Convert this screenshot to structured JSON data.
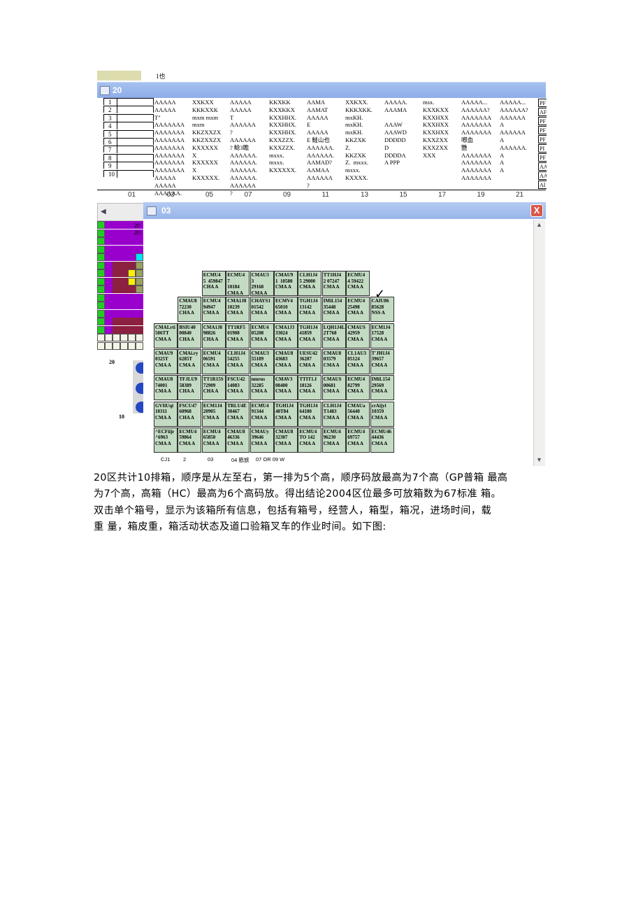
{
  "back_window": {
    "tab_note": "1也",
    "title": "20",
    "rows": [
      "1",
      "2",
      "3",
      "4",
      "5",
      "6",
      "7",
      "8",
      "9",
      "10"
    ],
    "columns": [
      {
        "label": "01",
        "text": "AAAAA\nAAAAA\nT\"\nAAAAAAA\nAAAAAAA\nAAAAAAA\nAAAAAAA\nAAAAAAA\nAAAAAAA\nAAAAAAA\nAAAAA\nAAAAA\nAAAAAA."
      },
      {
        "label": "03",
        "text": "XXKXX\nKKKXXK\nmxm mxm\nmxm\nKKZXXZX\nKKZXXZX\nKXXXXX\nX\nKXXXXX\nX\nKXXXXX."
      },
      {
        "label": "05",
        "text": "AAAAA\nAAAAA\nT\nAAAAAA\n?\nAAAAAA\n? 鲶3瞻\nAAAAAA.\nAAAAAA.\nAAAAAA.\nAAAAAA.\nAAAAAA\n?"
      },
      {
        "label": "07",
        "text": "KKXKK\nKXXKKX\nKXXHHX.\nKXXHHX.\nKXXHHX.\nKXXZZX.\nKXXZZX.\nmxxx.\nmxxx.\nKXXXXX."
      },
      {
        "label": "09",
        "text": "AAMA\nAAMAT\nAAAAA\nE\nAAAAA\nE 鮭山也\nAAAAAA.\nAAAAAA.\nAAMAD?\nAAMAA\nAAAAAA\n?"
      },
      {
        "label": "11",
        "text": "XXKXX.\nKKKXKK.\nmxKH.\nmxKH.\nmxKH.\nKKZXK\nZ.\nKKZXK\nZ.  mxxx.\nmxxx.\nKXXXX."
      },
      {
        "label": "13",
        "text": "AAAAA.\nAAAMA\n\nAAAW\nAAAWD\nDDDDD\nD\nDDDDA\nA PPP"
      },
      {
        "label": "15",
        "text": "msx.\nKXXKXX\nKXXHXX\nKXXHXX\nKXXHXX\nKXXZXX\nKXXZXX\nXXX"
      },
      {
        "label": "17",
        "text": "AAAAA...\nAAAAAA?\nAAAAAAA\nAAAAAAA\nAAAAAAA\n喞血\n艷\nAAAAAAA\nAAAAAAA\nAAAAAAA\nAAAAAAA"
      },
      {
        "label": "19",
        "text": "AAAAA...\nAAAAAA?\nAAAAAA\nA\nAAAAAA\nA\nAAAAAA.\nA\nA\nA"
      }
    ],
    "extra_labels": [
      "21"
    ],
    "right_codes": [
      "PF",
      "AF",
      "PF",
      "PF",
      "PF",
      "PI",
      "PF",
      "AA",
      "AA",
      "AI"
    ]
  },
  "left_panel": {
    "label_a": "20",
    "label_b": "20:",
    "label_c": "20",
    "label_d": "10"
  },
  "main_window": {
    "title": "03",
    "close_label": "X",
    "bay": {
      "rows": [
        [
          "",
          "",
          "ECMU4\n5  459847\nCHA A",
          "ECMU4\n7\n10184\nCMA A",
          "CMAU3\n3\n29168\nCMA A",
          "CMAU9\n1  10580\nCMA A",
          "CLH1J4\n5 29000\nCMA A",
          "TT1HJ4\n2 07247\nCMA A",
          "ECMU4\n4 59422\nCMA A",
          ""
        ],
        [
          "",
          "CMAU8\n72230\nCHA A",
          "ECMU4\n94947\nCMA A",
          "CMA1J8\n10239\nCMA A",
          "CHAYS1\n01542\nCMA A",
          "ECMV4\n65010\nCMA A",
          "TGH1J4\n13142\nCMA A",
          "IMiL154\n35448\nCMA A",
          "ECMU4\n25498\nCMA A",
          "CAIU86\n85628\nNSS A"
        ],
        [
          "CMALrti\n506TT\nCMA A",
          "BSIU40\n00840\nCHA A",
          "CMA1J8\n98826\nCHA A",
          "TT1RF5\n01908\nCMA A",
          "ECMU4\n05208\nCMA A",
          "CMA1J3\n33024\nCMA A",
          "TGH1J4\n41859\nCMA A",
          "LQH1J4L\n2T768\nCMA A",
          "CMAUS\n42959\nCMA A",
          "ECM1J4\n17528\nCMA A"
        ],
        [
          "CMAU9\n0325T\nCMA A",
          "CMAi.ry\n6285T\nCMA A",
          "ECMU4\n06591\nCMA A",
          "CLH1J4\n54255\nCMA A",
          "CMAU3\n55189\nCMA A",
          "CMAU8\n43683\nCMA A",
          "UESU42\n36287\nCMA A",
          "CMAU8\n03579\nCMA A",
          "CL1AU3\n05124\nCMA A",
          "T'JH1J4\n39657\nCMA A"
        ],
        [
          "CMAU8\n74001\nCMA A",
          "TFJLU9\n58389\nCHA A",
          "TT1R15S\n72909\nCHA A",
          "FSCU42\n14083\nCMA A",
          "nmrus\n32285\nCMA A",
          "CMAV3\n08400\nCMA A",
          "TTIT1.I\n18126\nCMA A",
          "CMAUS\n00681\nCMA A",
          "ECMU4\n82799\nCMA A",
          "IMiL154\n29569\nCMA A"
        ],
        [
          "GVIiUqi\n10311\nCMA A",
          "FSCU47\n60968\nCHA A",
          "ECM1J4\n20905\nCMA A",
          "TRLU4E\n30467\nCMA A",
          "ECMU4\n91344\nCMA A",
          "TGH1J4\n48T84\nCMA A",
          "TGH1J4\n64180\nCMA A",
          "CLH1J4\nT1483\nCMA A",
          "CMAUa\n56440\nCMA A",
          "crAijyi\n10359\nCMA A"
        ],
        [
          "^ECFiijr\n^6963\nCMA A",
          "ECMU4\n59864\nCMA A",
          "ECMU4\n65850\nCMA A",
          "CMAU8\n46336\nCMA A",
          "CMAUy\n39646\nCMA A",
          "CMAU8\n32307\nCMA A",
          "ECMU4\nTO 142\nCMA A",
          "ECMU4\n96230\nCMA A",
          "ECMU4\n69757\nCMA A",
          "ECMU46\n44436\nCMA A"
        ]
      ],
      "col_labels": [
        "CJ1",
        "2",
        "03",
        "04 筋旅",
        "07 OR 09 W"
      ]
    }
  },
  "paragraph": {
    "line1": "20区共计10排箱，顺序是从左至右，第一排为5个高，顺序码放最高为7个高（GP普箱 最高",
    "line2": "为7个高，高箱（HC）最高为6个高码放。得出结论2004区位最多可放箱数为67标准 箱。",
    "line3": "双击单个箱号，显示为该箱所有信息，包括有箱号，经营人，箱型，箱况，进场时间，载",
    "line4": "重 量，箱皮重，箱活动状态及道口验箱叉车的作业时间。如下图:"
  },
  "colors": {
    "title_bar": "#98b5ea",
    "slot_fill": "#c3dbc3",
    "close_button": "#d8584a",
    "mini_green": "#22cc22",
    "mini_purple": "#9900cc",
    "mini_maroon": "#8b2040",
    "mini_yellow": "#ffee00",
    "mini_cyan": "#00e5ff",
    "mini_olive": "#9aa060"
  }
}
